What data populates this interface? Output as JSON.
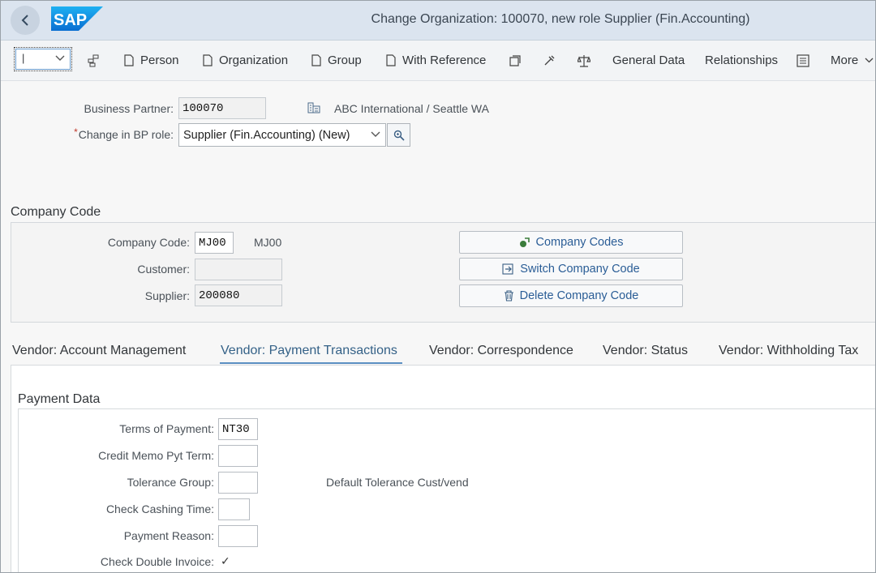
{
  "shell": {
    "title": "Change Organization: 100070, new role Supplier (Fin.Accounting)",
    "logo_text": "SAP"
  },
  "toolbar": {
    "select_value": "|",
    "items": [
      {
        "label": "Person"
      },
      {
        "label": "Organization"
      },
      {
        "label": "Group"
      },
      {
        "label": "With Reference"
      },
      {
        "label": "General Data"
      },
      {
        "label": "Relationships"
      },
      {
        "label": "More"
      }
    ]
  },
  "header": {
    "bp_label": "Business Partner:",
    "bp_value": "100070",
    "bp_name": "ABC International / Seattle WA",
    "role_label": "Change in BP role:",
    "role_required_marker": "*",
    "role_value": "Supplier (Fin.Accounting) (New)"
  },
  "company_code": {
    "section_title": "Company Code",
    "cc_label": "Company Code:",
    "cc_value": "MJ00",
    "cc_desc": "MJ00",
    "customer_label": "Customer:",
    "customer_value": "",
    "supplier_label": "Supplier:",
    "supplier_value": "200080",
    "buttons": {
      "company_codes": "Company Codes",
      "switch": "Switch Company Code",
      "delete": "Delete Company Code"
    }
  },
  "tabs": [
    {
      "label": "Vendor: Account Management",
      "active": false
    },
    {
      "label": "Vendor: Payment Transactions",
      "active": true
    },
    {
      "label": "Vendor: Correspondence",
      "active": false
    },
    {
      "label": "Vendor: Status",
      "active": false
    },
    {
      "label": "Vendor: Withholding Tax",
      "active": false
    }
  ],
  "payment_data": {
    "section_title": "Payment Data",
    "terms_label": "Terms of Payment:",
    "terms_value": "NT30",
    "credit_memo_label": "Credit Memo Pyt Term:",
    "credit_memo_value": "",
    "tolerance_label": "Tolerance Group:",
    "tolerance_value": "",
    "tolerance_desc": "Default Tolerance Cust/vend",
    "check_cashing_label": "Check Cashing Time:",
    "check_cashing_value": "",
    "payment_reason_label": "Payment Reason:",
    "payment_reason_value": "",
    "double_invoice_label": "Check Double Invoice:",
    "double_invoice_mark": "✓",
    "double_invoice_checked": true
  },
  "colors": {
    "shell_bg": "#dbe4ef",
    "logo_blue": "#1a8fe0",
    "link_blue": "#2a5d96",
    "active_tab": "#346187"
  },
  "icons": [
    "back-chevron-icon",
    "sap-logo",
    "chevron-down-icon",
    "hierarchy-icon",
    "document-icon",
    "copy-frame-icon",
    "tools-icon",
    "balance-icon",
    "table-icon",
    "building-icon",
    "search-icon",
    "company-icon",
    "switch-icon",
    "trash-icon"
  ]
}
